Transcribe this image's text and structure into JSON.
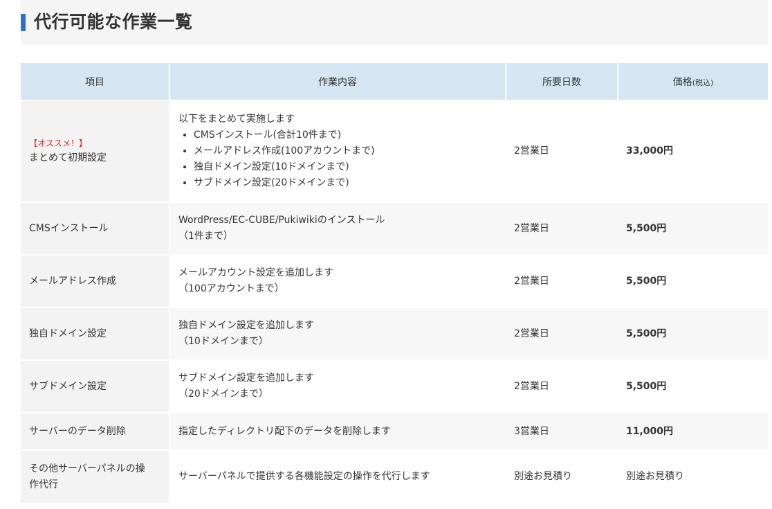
{
  "heading": {
    "title": "代行可能な作業一覧"
  },
  "table": {
    "headers": {
      "item": "項目",
      "content": "作業内容",
      "days": "所要日数",
      "price": "価格",
      "price_note": "(税込)"
    },
    "rows": [
      {
        "tag": "【オススメ！】",
        "item": "まとめて初期設定",
        "content_intro": "以下をまとめて実施します",
        "bullets": [
          "CMSインストール(合計10件まで)",
          "メールアドレス作成(100アカウントまで)",
          "独自ドメイン設定(10ドメインまで)",
          "サブドメイン設定(20ドメインまで)"
        ],
        "days": "2営業日",
        "price": "33,000円"
      },
      {
        "item": "CMSインストール",
        "content": "WordPress/EC-CUBE/Pukiwikiのインストール",
        "content_note": "（1件まで）",
        "days": "2営業日",
        "price": "5,500円"
      },
      {
        "item": "メールアドレス作成",
        "content": "メールアカウント設定を追加します",
        "content_note": "（100アカウントまで）",
        "days": "2営業日",
        "price": "5,500円"
      },
      {
        "item": "独自ドメイン設定",
        "content": "独自ドメイン設定を追加します",
        "content_note": "（10ドメインまで）",
        "days": "2営業日",
        "price": "5,500円"
      },
      {
        "item": "サブドメイン設定",
        "content": "サブドメイン設定を追加します",
        "content_note": "（20ドメインまで）",
        "days": "2営業日",
        "price": "5,500円"
      },
      {
        "item": "サーバーのデータ削除",
        "content": "指定したディレクトリ配下のデータを削除します",
        "days": "3営業日",
        "price": "11,000円"
      },
      {
        "item_line1": "その他サーバーパネルの操",
        "item_line2": "作代行",
        "content": "サーバーパネルで提供する各機能設定の操作を代行します",
        "days": "別途お見積り",
        "price": "別途お見積り"
      }
    ]
  }
}
